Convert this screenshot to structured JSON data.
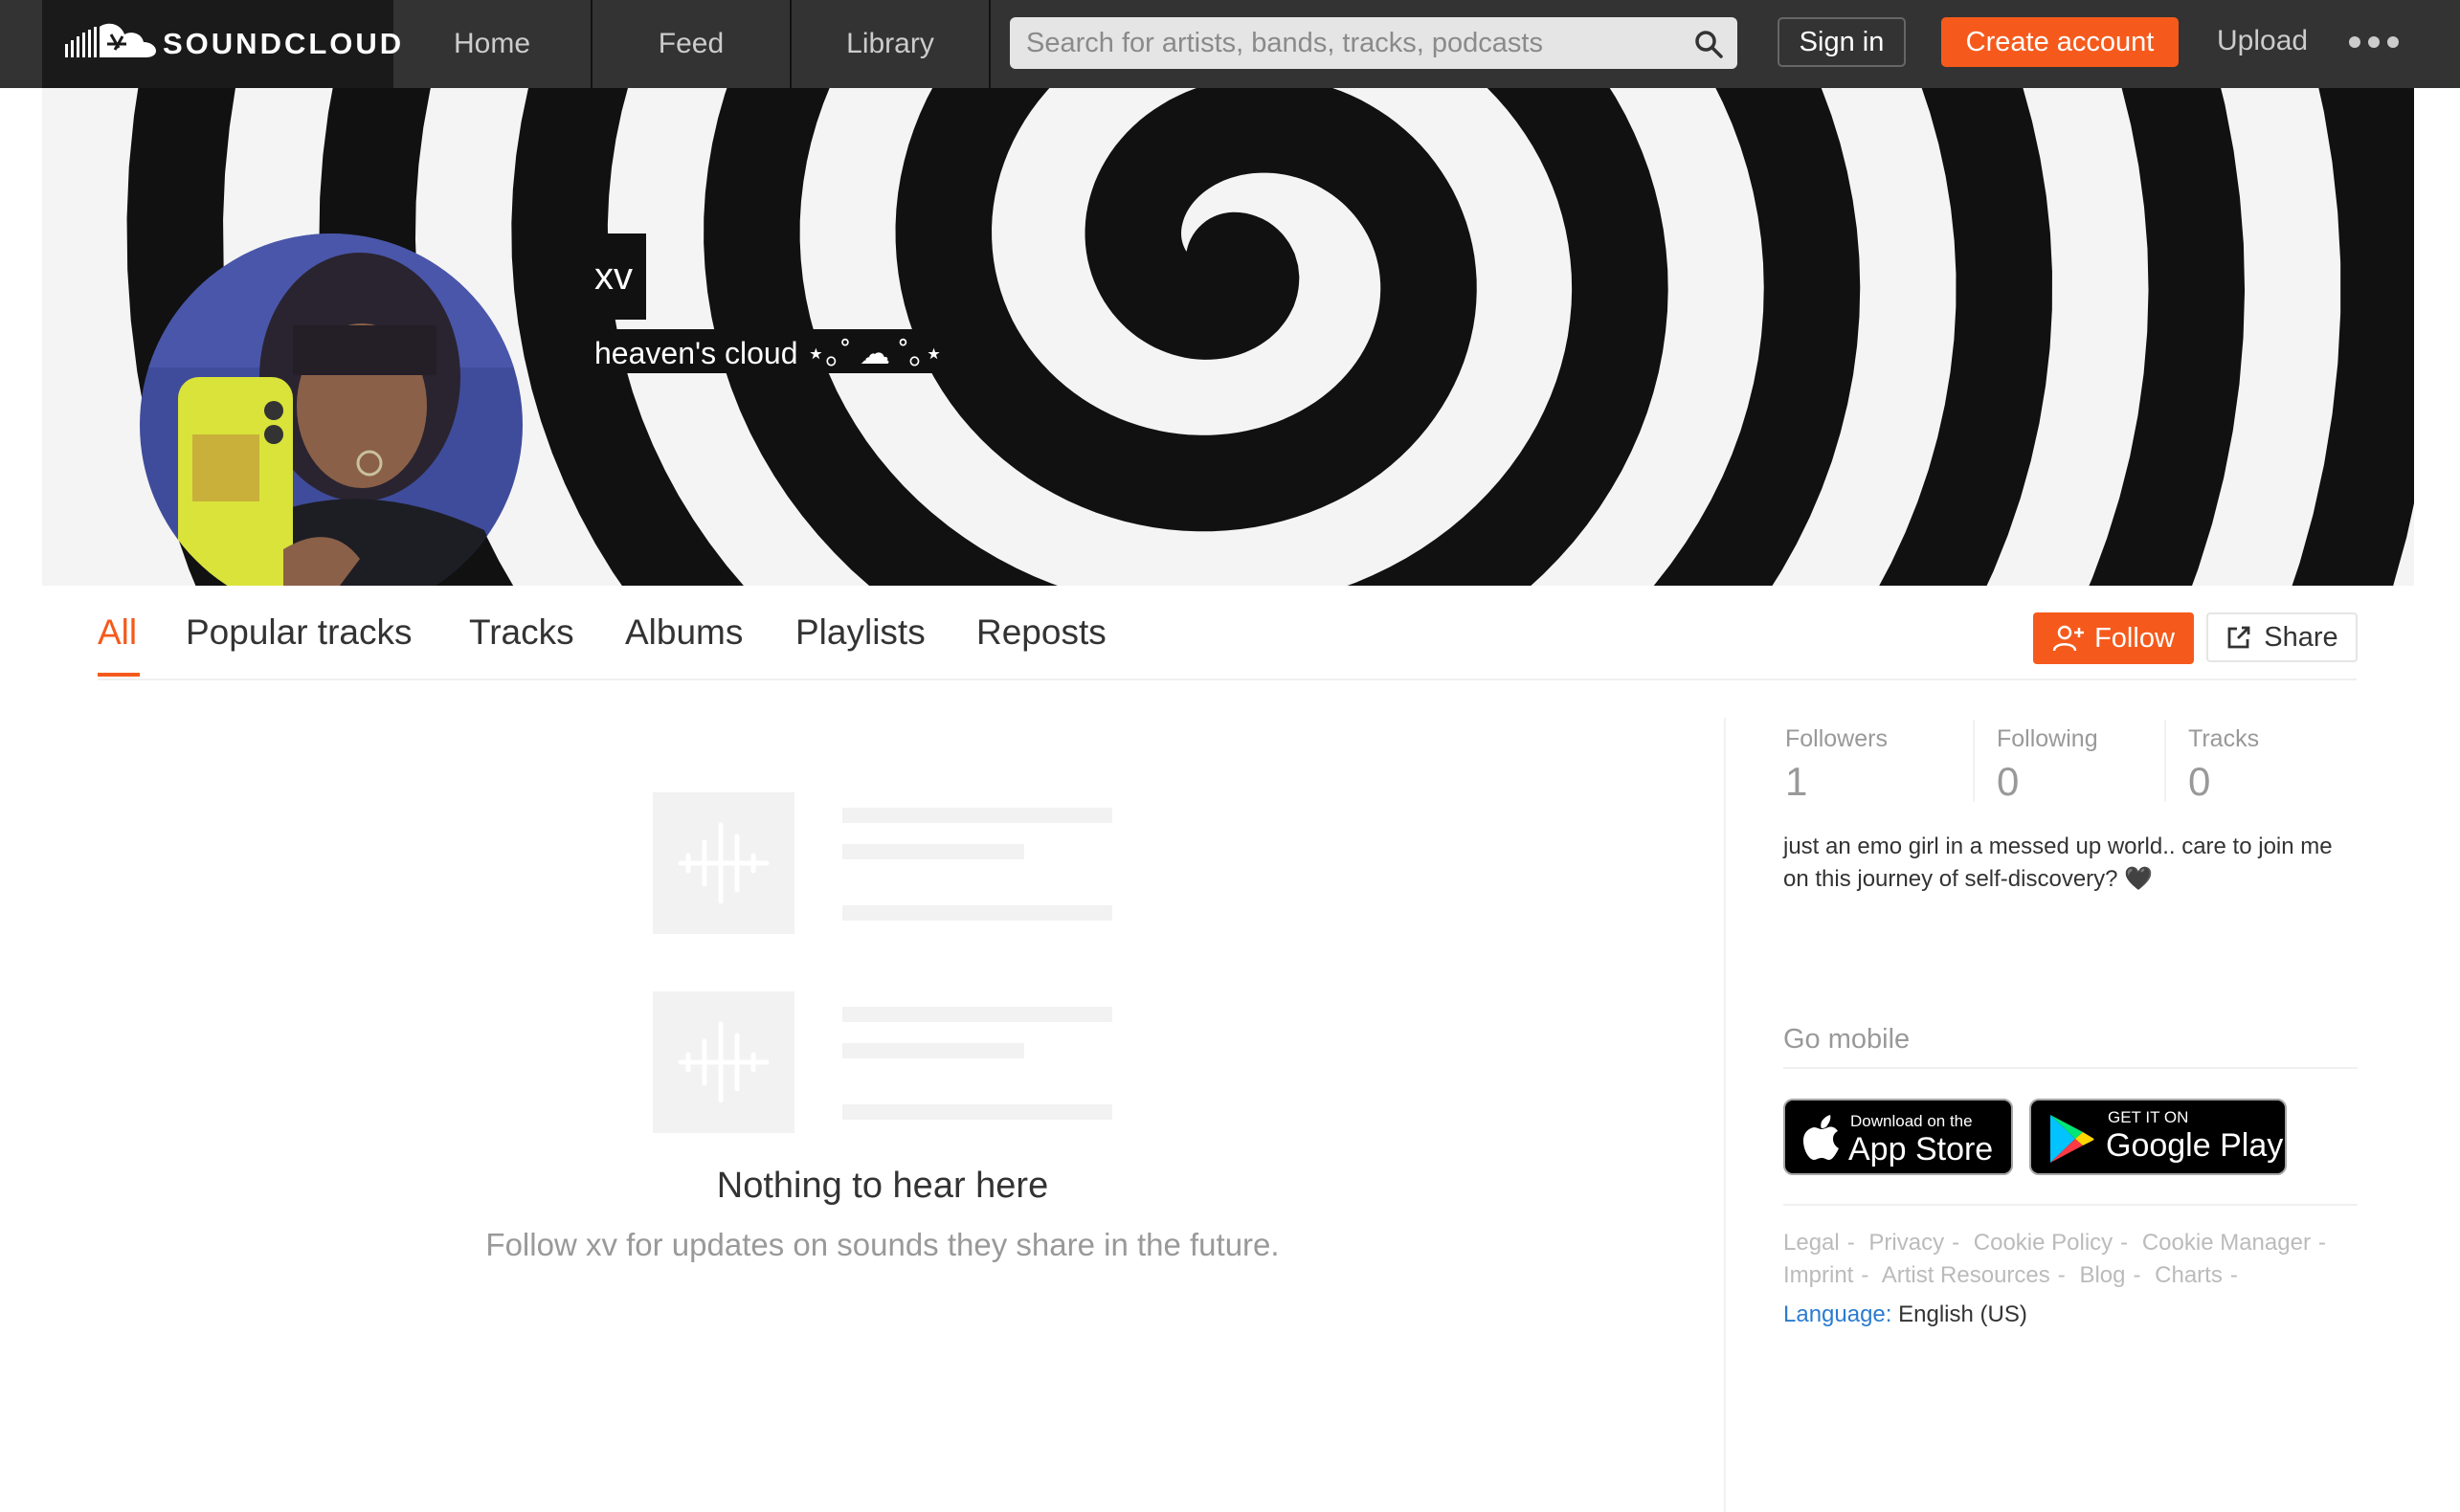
{
  "brand": {
    "logo_text": "SOUNDCLOUD"
  },
  "nav": {
    "tabs": [
      "Home",
      "Feed",
      "Library"
    ]
  },
  "search": {
    "placeholder": "Search for artists, bands, tracks, podcasts"
  },
  "header_actions": {
    "sign_in": "Sign in",
    "create_account": "Create account",
    "upload": "Upload",
    "more_icon": "more-dots-icon"
  },
  "profile": {
    "username": "xv",
    "tagline": "heaven's cloud ⋆｡˚ ☁︎ ˚｡⋆"
  },
  "profile_tabs": {
    "items": [
      "All",
      "Popular tracks",
      "Tracks",
      "Albums",
      "Playlists",
      "Reposts"
    ],
    "active": "All"
  },
  "actions": {
    "follow": "Follow",
    "share": "Share"
  },
  "empty_state": {
    "title": "Nothing to hear here",
    "subtitle": "Follow xv for updates on sounds they share in the future."
  },
  "stats": {
    "items": [
      {
        "label": "Followers",
        "value": "1"
      },
      {
        "label": "Following",
        "value": "0"
      },
      {
        "label": "Tracks",
        "value": "0"
      }
    ]
  },
  "bio": "just an emo girl in a messed up world.. care to join me on this journey of self-discovery? 🖤",
  "mobile": {
    "heading": "Go mobile",
    "app_store": {
      "small": "Download on the",
      "big": "App Store"
    },
    "google_play": {
      "small": "GET IT ON",
      "big": "Google Play"
    }
  },
  "footer": {
    "links": [
      "Legal",
      "Privacy",
      "Cookie Policy",
      "Cookie Manager",
      "Imprint",
      "Artist Resources",
      "Blog",
      "Charts"
    ],
    "language_label": "Language:",
    "language_value": "English (US)"
  },
  "colors": {
    "accent": "#f55a1c",
    "topbar": "#333333",
    "link": "#2a7ccf"
  }
}
